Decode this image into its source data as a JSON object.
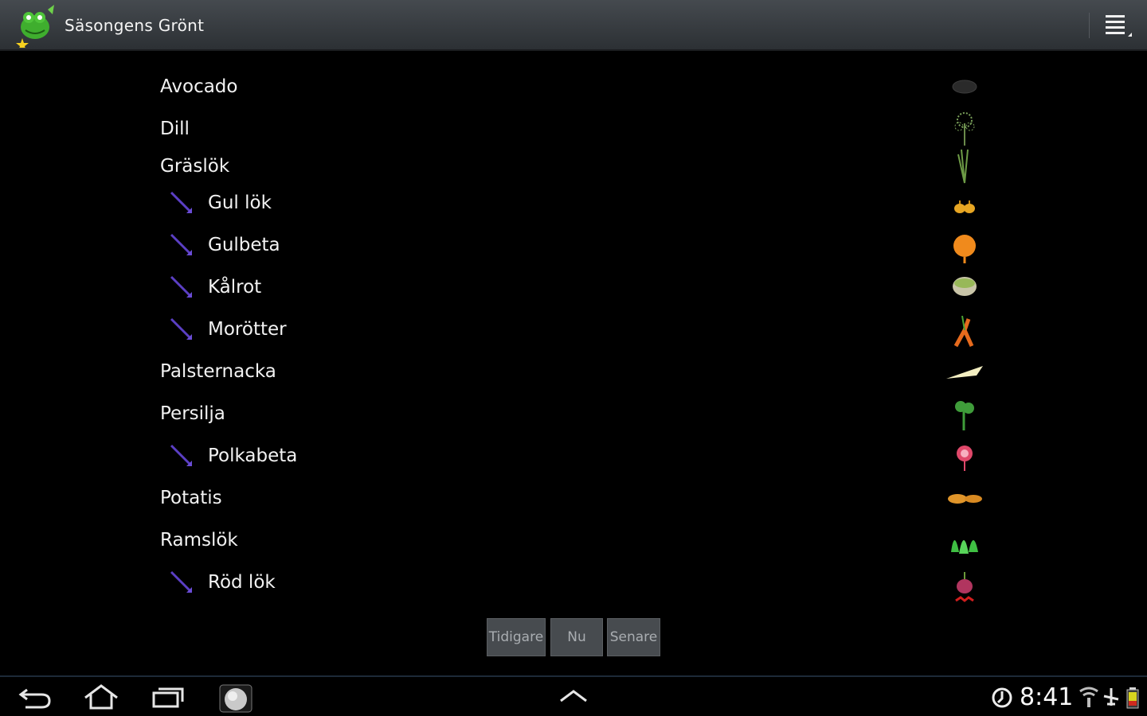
{
  "app": {
    "title": "Säsongens Grönt",
    "menu_icon": "overflow-menu-icon",
    "logo_icon": "frog-logo-icon"
  },
  "list": {
    "items": [
      {
        "label": "Avocado",
        "marked": false,
        "icon": "avocado-icon"
      },
      {
        "label": "Dill",
        "marked": false,
        "icon": "dill-icon"
      },
      {
        "label": "Gräslök",
        "marked": false,
        "icon": "chives-icon"
      },
      {
        "label": "Gul lök",
        "marked": true,
        "icon": "yellow-onion-icon"
      },
      {
        "label": "Gulbeta",
        "marked": true,
        "icon": "yellow-beet-icon"
      },
      {
        "label": "Kålrot",
        "marked": true,
        "icon": "rutabaga-icon"
      },
      {
        "label": "Morötter",
        "marked": true,
        "icon": "carrots-icon"
      },
      {
        "label": "Palsternacka",
        "marked": false,
        "icon": "parsnip-icon"
      },
      {
        "label": "Persilja",
        "marked": false,
        "icon": "parsley-icon"
      },
      {
        "label": "Polkabeta",
        "marked": true,
        "icon": "polka-beet-icon"
      },
      {
        "label": "Potatis",
        "marked": false,
        "icon": "potato-icon"
      },
      {
        "label": "Ramslök",
        "marked": false,
        "icon": "ramsons-icon"
      },
      {
        "label": "Röd lök",
        "marked": true,
        "icon": "red-onion-icon"
      }
    ]
  },
  "period": {
    "earlier": "Tidigare",
    "now": "Nu",
    "later": "Senare"
  },
  "system": {
    "time": "8:41",
    "accent": "#2e4d6b"
  },
  "colors": {
    "marker": "#5b3fc4",
    "text": "#f2f2f2",
    "background": "#000000"
  }
}
